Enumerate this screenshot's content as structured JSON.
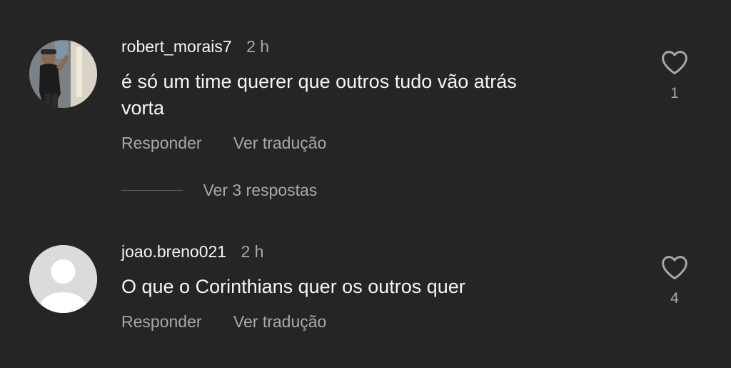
{
  "comments": [
    {
      "username": "robert_morais7",
      "time": "2 h",
      "text_line1": "é só um time querer que outros tudo vão atrás",
      "text_line2": "vorta",
      "reply_label": "Responder",
      "translate_label": "Ver tradução",
      "likes": "1",
      "avatar": "profile-photo"
    },
    {
      "username": "joao.breno021",
      "time": "2 h",
      "text_line1": "O que o Corinthians quer os outros quer",
      "reply_label": "Responder",
      "translate_label": "Ver tradução",
      "likes": "4",
      "avatar": "default-avatar"
    }
  ],
  "replies_toggle": "Ver 3 respostas",
  "icons": {
    "like": "heart-outline-icon"
  },
  "colors": {
    "background": "#252525",
    "primary_text": "#f5f5f5",
    "secondary_text": "#a8a8a8"
  }
}
